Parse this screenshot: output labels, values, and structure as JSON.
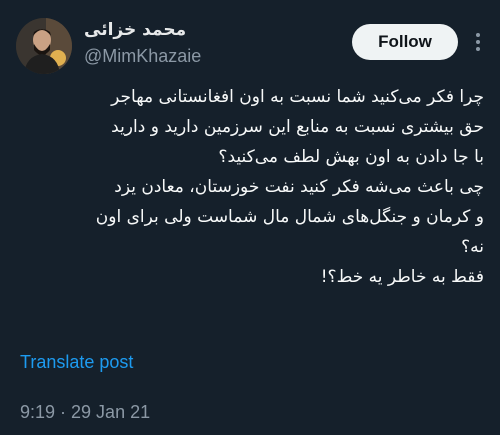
{
  "author": {
    "display_name": "محمد خزائی",
    "handle": "@MimKhazaie"
  },
  "follow_button": {
    "label": "Follow"
  },
  "more_menu": {
    "icon": "more-vertical-icon"
  },
  "tweet": {
    "lines": [
      "چرا فکر می‌کنید شما نسبت به اون افغانستانی مهاجر",
      "حق بیشتری نسبت به منابع این سرزمین دارید و دارید",
      "با جا دادن به اون بهش لطف می‌کنید؟",
      "چی باعث می‌شه فکر کنید نفت خوزستان، معادن یزد",
      "و کرمان و جنگل‌های شمال مال شماست ولی برای اون",
      "نه؟",
      "فقط به خاطر یه خط؟!"
    ]
  },
  "translate_link": "Translate post",
  "timestamp": "9:19 · 29 Jan 21",
  "colors": {
    "background": "#15202b",
    "text": "#f7f9f9",
    "secondary_text": "#8b98a5",
    "link": "#1d9bf0",
    "button_bg": "#eff3f4"
  }
}
